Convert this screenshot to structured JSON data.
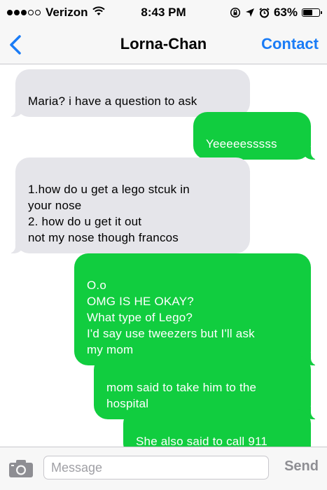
{
  "status_bar": {
    "carrier": "Verizon",
    "time": "8:43 PM",
    "battery": "63%",
    "battery_level": 0.63,
    "signal_bars_filled": 3,
    "signal_bars_total": 5
  },
  "nav": {
    "back_icon": "chevron-left-icon",
    "title": "Lorna-Chan",
    "contact_label": "Contact",
    "accent_color": "#1a7cf6"
  },
  "messages": [
    {
      "direction": "incoming",
      "text": "Maria? i have a question to ask"
    },
    {
      "direction": "outgoing",
      "text": "Yeeeeesssss"
    },
    {
      "direction": "incoming",
      "text": "1.how do u get a lego stcuk in\nyour nose\n2. how do u get it out\nnot my nose though francos"
    },
    {
      "direction": "outgoing",
      "text": "O.o\nOMG IS HE OKAY?\nWhat type of Lego?\nI'd say use tweezers but I'll ask\nmy mom"
    },
    {
      "direction": "outgoing",
      "text": "mom said to take him to the\nhospital"
    },
    {
      "direction": "outgoing",
      "text": "She also said to call 911"
    }
  ],
  "compose": {
    "camera_icon": "camera-icon",
    "placeholder": "Message",
    "value": "",
    "send_label": "Send"
  },
  "colors": {
    "outgoing_bubble": "#11cd3f",
    "incoming_bubble": "#e5e5ea"
  }
}
